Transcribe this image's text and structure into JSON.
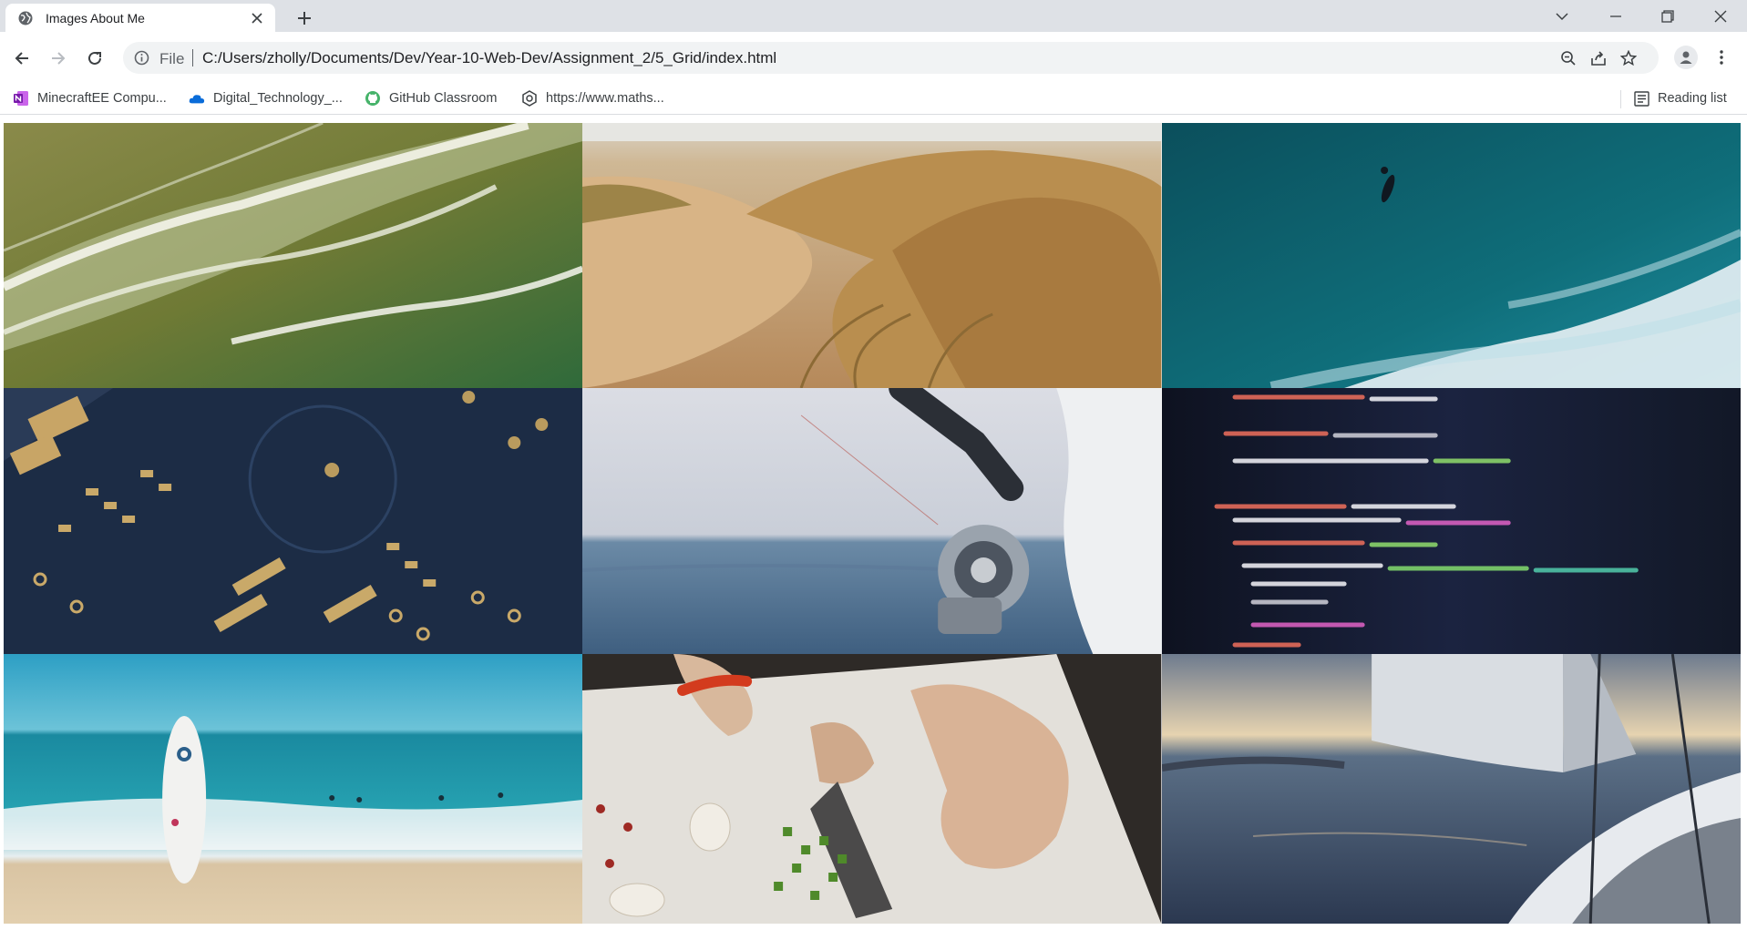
{
  "browser": {
    "tab": {
      "title": "Images About Me",
      "favicon": "globe-icon"
    },
    "window_controls": [
      "chevron-down-icon",
      "minimize-icon",
      "restore-icon",
      "close-icon"
    ],
    "omnibox": {
      "scheme_label": "File",
      "url": "C:/Users/zholly/Documents/Dev/Year-10-Web-Dev/Assignment_2/5_Grid/index.html"
    },
    "bookmarks": [
      {
        "label": "MinecraftEE Compu...",
        "icon": "onenote-icon"
      },
      {
        "label": "Digital_Technology_...",
        "icon": "onedrive-cloud-icon"
      },
      {
        "label": "GitHub Classroom",
        "icon": "github-icon"
      },
      {
        "label": "https://www.maths...",
        "icon": "site-icon"
      }
    ],
    "reading_list_label": "Reading list"
  },
  "page": {
    "images": [
      {
        "subject": "ocean-waves-aerial",
        "palette": "#6f7a35"
      },
      {
        "subject": "sand-dunes-grass",
        "palette": "#c9a46b"
      },
      {
        "subject": "surfer-ocean-aerial",
        "palette": "#0f5f6b"
      },
      {
        "subject": "circuit-board",
        "palette": "#1c2c45"
      },
      {
        "subject": "fishing-reel-sea",
        "palette": "#4f6f8a"
      },
      {
        "subject": "code-on-screen",
        "palette": "#141a2b"
      },
      {
        "subject": "surfboard-beach",
        "palette": "#3fa9bf"
      },
      {
        "subject": "chopping-vegetables",
        "palette": "#8e8a84"
      },
      {
        "subject": "sailboat-sunset",
        "palette": "#3e4a5c"
      }
    ]
  }
}
